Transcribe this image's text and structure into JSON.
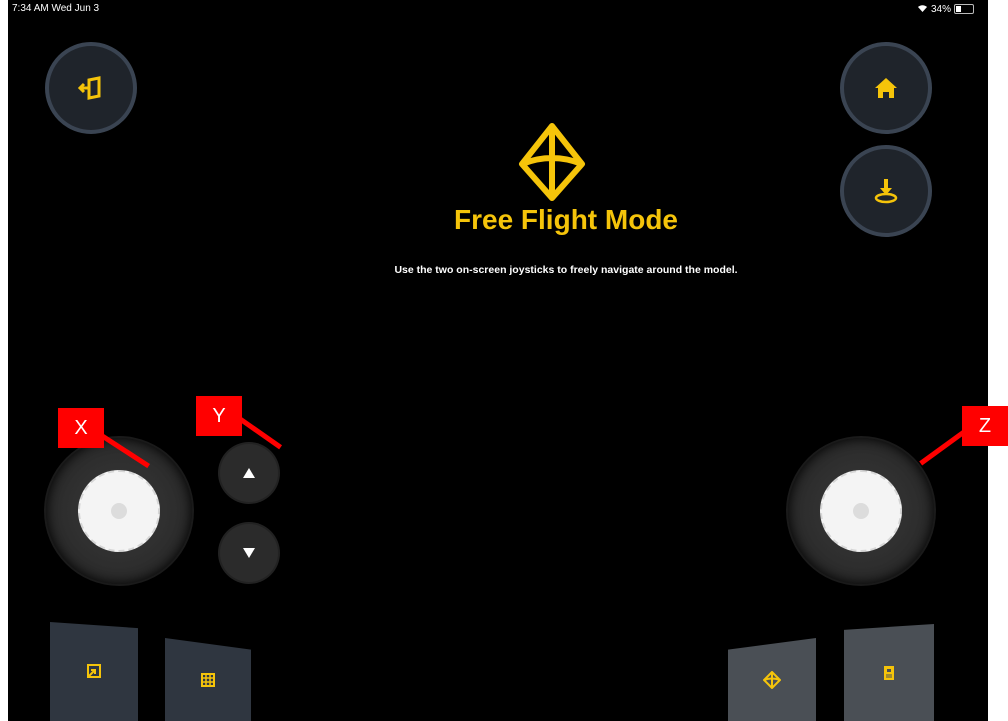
{
  "status_bar": {
    "time_date": "7:34 AM   Wed Jun 3",
    "battery": "34%",
    "battery_level": 0.34
  },
  "mode": {
    "title": "Free Flight Mode",
    "description": "Use the two on-screen joysticks to freely navigate around the model."
  },
  "buttons": {
    "exit": "exit-icon",
    "home": "home-icon",
    "download": "download-icon",
    "up": "triangle-up-icon",
    "down": "triangle-down-icon"
  },
  "annotations": {
    "x": "X",
    "y": "Y",
    "z": "Z"
  },
  "colors": {
    "accent": "#f5c40a",
    "background": "#000000",
    "button_ring": "#3a4452",
    "annotation": "#ff0000"
  }
}
